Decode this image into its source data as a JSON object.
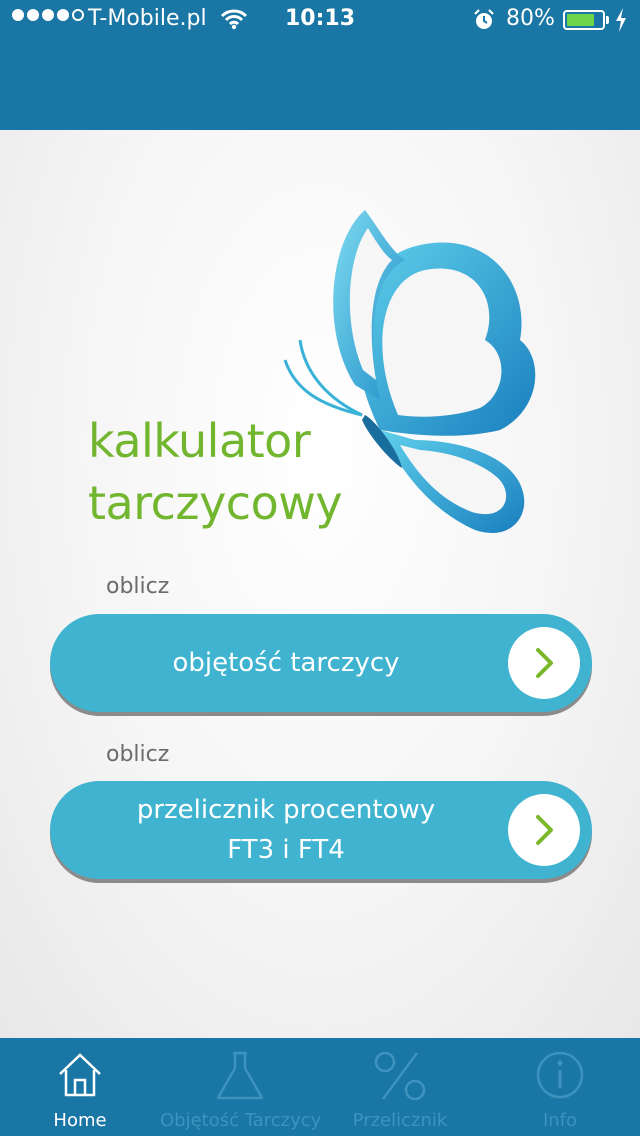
{
  "status_bar": {
    "carrier": "T-Mobile.pl",
    "time": "10:13",
    "battery_percent": "80%",
    "battery_level": 0.8,
    "signal_bars_filled": 4,
    "signal_bars_total": 5
  },
  "logo": {
    "line1": "kalkulator",
    "line2": "tarczycowy"
  },
  "actions": [
    {
      "caption": "oblicz",
      "label": "objętość tarczycy"
    },
    {
      "caption": "oblicz",
      "label_line1": "przelicznik procentowy",
      "label_line2": "FT3 i FT4"
    }
  ],
  "tabs": [
    {
      "label": "Home",
      "icon": "home-icon",
      "active": true
    },
    {
      "label": "Objętość Tarczycy",
      "icon": "flask-icon",
      "active": false
    },
    {
      "label": "Przelicznik",
      "icon": "percent-icon",
      "active": false
    },
    {
      "label": "Info",
      "icon": "info-icon",
      "active": false
    }
  ],
  "colors": {
    "header": "#1a76a4",
    "button": "#3fb3d0",
    "logo_text": "#72b62f",
    "arrow": "#7ab82a"
  }
}
